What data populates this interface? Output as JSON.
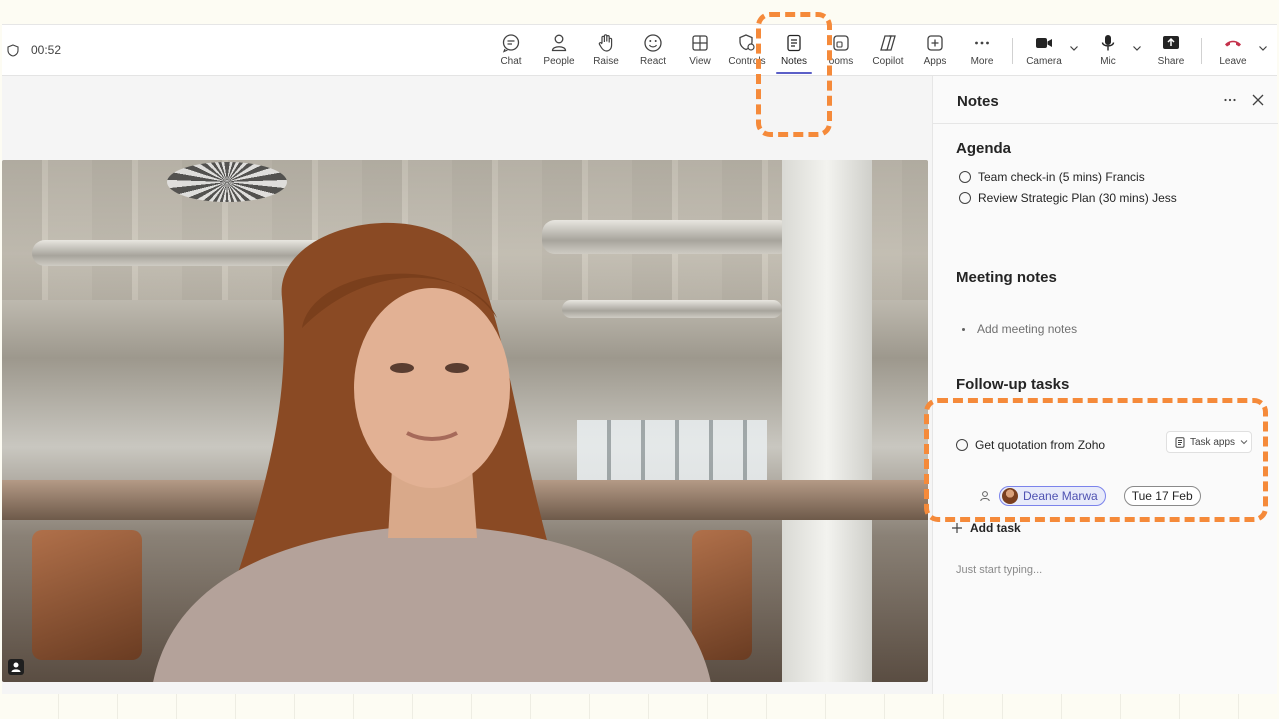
{
  "meeting": {
    "timer": "00:52"
  },
  "toolbar": {
    "buttons": [
      {
        "id": "chat",
        "label": "Chat",
        "icon": "chat-icon"
      },
      {
        "id": "people",
        "label": "People",
        "icon": "people-icon"
      },
      {
        "id": "raise",
        "label": "Raise",
        "icon": "hand-icon"
      },
      {
        "id": "react",
        "label": "React",
        "icon": "smiley-icon"
      },
      {
        "id": "view",
        "label": "View",
        "icon": "grid-icon"
      },
      {
        "id": "controls",
        "label": "Controls",
        "icon": "shield-gear-icon"
      },
      {
        "id": "notes",
        "label": "Notes",
        "icon": "notes-icon",
        "active": true
      },
      {
        "id": "rooms",
        "label": "ooms",
        "icon": "rooms-icon"
      },
      {
        "id": "copilot",
        "label": "Copilot",
        "icon": "copilot-icon"
      },
      {
        "id": "apps",
        "label": "Apps",
        "icon": "plus-square-icon"
      },
      {
        "id": "more",
        "label": "More",
        "icon": "ellipsis-icon"
      },
      {
        "id": "camera",
        "label": "Camera",
        "icon": "camera-icon"
      },
      {
        "id": "mic",
        "label": "Mic",
        "icon": "mic-icon"
      },
      {
        "id": "share",
        "label": "Share",
        "icon": "share-icon"
      },
      {
        "id": "leave",
        "label": "Leave",
        "icon": "phone-hangup-icon"
      }
    ],
    "accent": "#5b5fc7",
    "leave_color": "#c4314b"
  },
  "notes": {
    "title": "Notes",
    "agenda": {
      "title": "Agenda",
      "items": [
        "Team check-in (5 mins) Francis",
        "Review Strategic Plan (30 mins) Jess"
      ]
    },
    "meeting_notes": {
      "title": "Meeting notes",
      "placeholder": "Add meeting notes"
    },
    "followup": {
      "title": "Follow-up tasks",
      "task_apps_label": "Task apps",
      "tasks": [
        {
          "title": "Get quotation from Zoho",
          "assignee": "Deane Marwa",
          "due": "Tue 17 Feb"
        }
      ],
      "add_task_label": "Add task"
    },
    "typing_placeholder": "Just start typing..."
  },
  "annotation": {
    "callout_color": "#f58a3a"
  }
}
